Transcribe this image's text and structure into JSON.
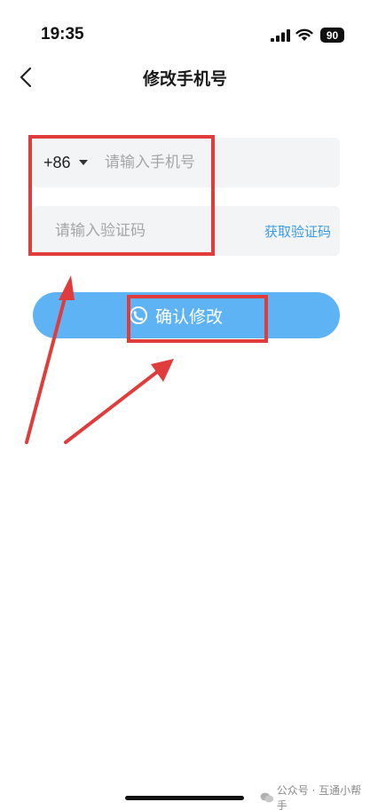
{
  "status_bar": {
    "time": "19:35",
    "battery": "90",
    "icons": [
      "signal-icon",
      "wifi-icon",
      "battery-icon"
    ]
  },
  "nav": {
    "title": "修改手机号",
    "back_icon": "chevron-left-icon"
  },
  "form": {
    "country_code": "+86",
    "phone_placeholder": "请输入手机号",
    "code_placeholder": "请输入验证码",
    "get_code_label": "获取验证码"
  },
  "confirm_button": {
    "label": "确认修改",
    "icon": "headset-icon"
  },
  "watermark": {
    "text": "公众号 · 互通小帮手"
  },
  "colors": {
    "accent": "#5eb3f5",
    "link": "#3a9be8",
    "annotation": "#e03c3c",
    "field_bg": "#f3f4f6"
  }
}
